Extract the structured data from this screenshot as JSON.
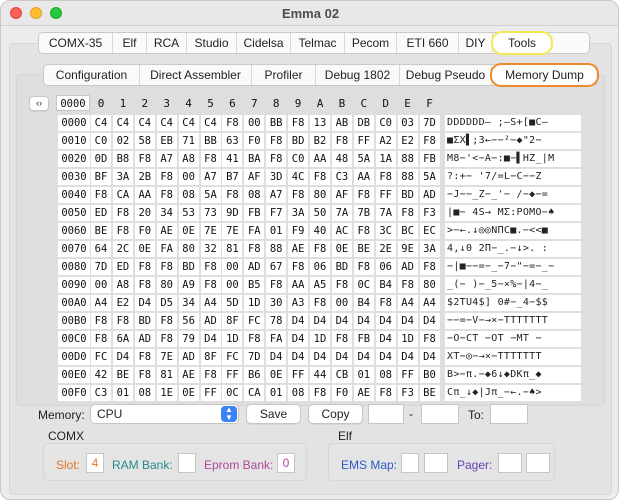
{
  "window": {
    "title": "Emma 02"
  },
  "computer_tabs": [
    "COMX-35",
    "Elf",
    "RCA",
    "Studio",
    "Cidelsa",
    "Telmac",
    "Pecom",
    "ETI 660",
    "DIY",
    "Tools"
  ],
  "tool_tabs": [
    "Configuration",
    "Direct Assembler",
    "Profiler",
    "Debug 1802",
    "Debug Pseudo",
    "Memory Dump"
  ],
  "dump": {
    "start": "0000",
    "nav_icon": "left-right-arrows-icon",
    "col_headers": [
      "0",
      "1",
      "2",
      "3",
      "4",
      "5",
      "6",
      "7",
      "8",
      "9",
      "A",
      "B",
      "C",
      "D",
      "E",
      "F"
    ],
    "rows": [
      {
        "addr": "0000",
        "bytes": [
          "C4",
          "C4",
          "C4",
          "C4",
          "C4",
          "C4",
          "F8",
          "00",
          "BB",
          "F8",
          "13",
          "AB",
          "DB",
          "C0",
          "03",
          "7D"
        ],
        "ascii": "DDDDDD— ;—S+[■C—"
      },
      {
        "addr": "0010",
        "bytes": [
          "C0",
          "02",
          "58",
          "EB",
          "71",
          "BB",
          "63",
          "F0",
          "F8",
          "BD",
          "B2",
          "F8",
          "FF",
          "A2",
          "E2",
          "F8"
        ],
        "ascii": "■ΣX▌;3←−−²−◆\"2−"
      },
      {
        "addr": "0020",
        "bytes": [
          "0D",
          "B8",
          "F8",
          "A7",
          "A8",
          "F8",
          "41",
          "BA",
          "F8",
          "C0",
          "AA",
          "48",
          "5A",
          "1A",
          "88",
          "FB"
        ],
        "ascii": "M8−'<−A−:■−▌HZ_|M"
      },
      {
        "addr": "0030",
        "bytes": [
          "BF",
          "3A",
          "2B",
          "F8",
          "00",
          "A7",
          "B7",
          "AF",
          "3D",
          "4C",
          "F8",
          "C3",
          "AA",
          "F8",
          "88",
          "5A"
        ],
        "ascii": "?:+− '7/=L−C−−Z"
      },
      {
        "addr": "0040",
        "bytes": [
          "F8",
          "CA",
          "AA",
          "F8",
          "08",
          "5A",
          "F8",
          "08",
          "A7",
          "F8",
          "80",
          "AF",
          "F8",
          "FF",
          "BD",
          "AD"
        ],
        "ascii": "−J−−_Z−_'− /−◆−="
      },
      {
        "addr": "0050",
        "bytes": [
          "ED",
          "F8",
          "20",
          "34",
          "53",
          "73",
          "9D",
          "FB",
          "F7",
          "3A",
          "50",
          "7A",
          "7B",
          "7A",
          "F8",
          "F3"
        ],
        "ascii": "|■− 4S→ MΣ:POMO−♠"
      },
      {
        "addr": "0060",
        "bytes": [
          "BE",
          "F8",
          "F0",
          "AE",
          "0E",
          "7E",
          "7E",
          "FA",
          "01",
          "F9",
          "40",
          "AC",
          "F8",
          "3C",
          "BC",
          "EC"
        ],
        "ascii": ">−←.↓◎◎NΠC■.−<<■"
      },
      {
        "addr": "0070",
        "bytes": [
          "64",
          "2C",
          "0E",
          "FA",
          "80",
          "32",
          "81",
          "F8",
          "88",
          "AE",
          "F8",
          "0E",
          "BE",
          "2E",
          "9E",
          "3A"
        ],
        "ascii": "4,↓0 2Π−_.−↓>. :"
      },
      {
        "addr": "0080",
        "bytes": [
          "7D",
          "ED",
          "F8",
          "F8",
          "BD",
          "F8",
          "00",
          "AD",
          "67",
          "F8",
          "06",
          "BD",
          "F8",
          "06",
          "AD",
          "F8"
        ],
        "ascii": "−|■−−=−_−7−\"−=−_−"
      },
      {
        "addr": "0090",
        "bytes": [
          "00",
          "A8",
          "F8",
          "80",
          "A9",
          "F8",
          "00",
          "B5",
          "F8",
          "AA",
          "A5",
          "F8",
          "0C",
          "B4",
          "F8",
          "80"
        ],
        "ascii": "_(− )−_5−×%−|4−_"
      },
      {
        "addr": "00A0",
        "bytes": [
          "A4",
          "E2",
          "D4",
          "D5",
          "34",
          "A4",
          "5D",
          "1D",
          "30",
          "A3",
          "F8",
          "00",
          "B4",
          "F8",
          "A4",
          "A4"
        ],
        "ascii": "$2TU4$] 0#−_4−$$"
      },
      {
        "addr": "00B0",
        "bytes": [
          "F8",
          "F8",
          "BD",
          "F8",
          "56",
          "AD",
          "8F",
          "FC",
          "78",
          "D4",
          "D4",
          "D4",
          "D4",
          "D4",
          "D4",
          "D4"
        ],
        "ascii": "−−=−V−→×−TTTTTTT"
      },
      {
        "addr": "00C0",
        "bytes": [
          "F8",
          "6A",
          "AD",
          "F8",
          "79",
          "D4",
          "1D",
          "F8",
          "FA",
          "D4",
          "1D",
          "F8",
          "FB",
          "D4",
          "1D",
          "F8"
        ],
        "ascii": "−O−CT −OT −MT −"
      },
      {
        "addr": "00D0",
        "bytes": [
          "FC",
          "D4",
          "F8",
          "7E",
          "AD",
          "8F",
          "FC",
          "7D",
          "D4",
          "D4",
          "D4",
          "D4",
          "D4",
          "D4",
          "D4",
          "D4"
        ],
        "ascii": "XT−◎−→×−TTTTTTT"
      },
      {
        "addr": "00E0",
        "bytes": [
          "42",
          "BE",
          "F8",
          "81",
          "AE",
          "F8",
          "FF",
          "B6",
          "0E",
          "FF",
          "44",
          "CB",
          "01",
          "08",
          "FF",
          "B0"
        ],
        "ascii": "B>−π.−◆6↓◆DKπ_◆"
      },
      {
        "addr": "00F0",
        "bytes": [
          "C3",
          "01",
          "08",
          "1E",
          "0E",
          "FF",
          "0C",
          "CA",
          "01",
          "08",
          "F8",
          "F0",
          "AE",
          "F8",
          "F3",
          "BE"
        ],
        "ascii": "Cπ_↓◆|Jπ_−←.−♠>"
      }
    ]
  },
  "memory_row": {
    "label": "Memory:",
    "select_value": "CPU",
    "save_label": "Save",
    "copy_label": "Copy",
    "dash": "-",
    "to_label": "To:"
  },
  "comx": {
    "heading": "COMX",
    "slot_label": "Slot:",
    "slot_value": "4",
    "ram_bank_label": "RAM Bank:",
    "eprom_bank_label": "Eprom Bank:",
    "eprom_bank_value": "0"
  },
  "elf": {
    "heading": "Elf",
    "ems_map_label": "EMS Map:",
    "pager_label": "Pager:"
  },
  "colors": {
    "slot": "#e8742a",
    "ram_bank": "#2a8a8a",
    "eprom_bank": "#b0479e",
    "ems": "#2f58c9",
    "pager": "#6a3fb5",
    "tools_highlight": "#f2e94e",
    "memdump_highlight": "#ef8a2a"
  }
}
